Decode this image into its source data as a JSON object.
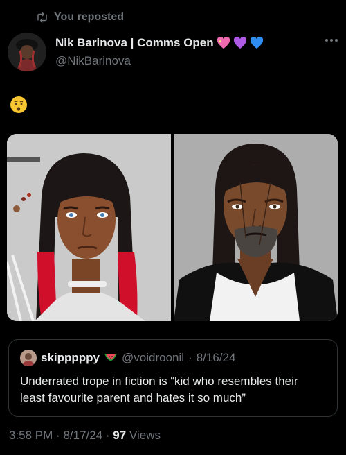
{
  "repost": {
    "label": "You reposted",
    "icon": "repost-icon"
  },
  "author": {
    "display_name": "Nik Barinova | Comms Open",
    "handle": "@NikBarinova",
    "badges": [
      "sparkling-heart-icon",
      "purple-heart-icon",
      "blue-heart-icon"
    ]
  },
  "post": {
    "emoji": "kissing-face-emoji"
  },
  "media": {
    "images": [
      "portrait-young-woman",
      "portrait-bearded-man"
    ]
  },
  "quote": {
    "name": "skipppppy",
    "name_emoji": "watermelon-icon",
    "handle": "@voidroonil",
    "date": "8/16/24",
    "text": "Underrated trope in fiction is “kid who resembles their least favourite parent and hates it so much”"
  },
  "footer": {
    "time": "3:58 PM",
    "date": "8/17/24",
    "views_count": "97",
    "views_label": "Views"
  },
  "colors": {
    "background": "#000000",
    "primary_text": "#e7e9ea",
    "secondary_text": "#71767b",
    "border": "#2f3336"
  }
}
